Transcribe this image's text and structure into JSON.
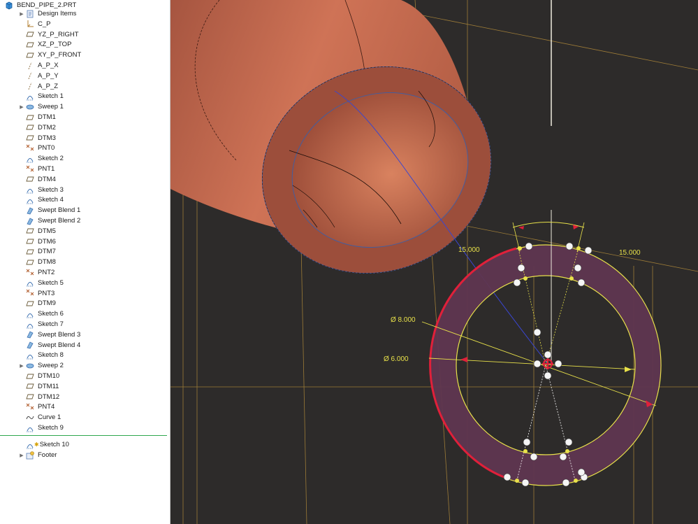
{
  "model_tree": {
    "root": "BEND_PIPE_2.PRT",
    "items": [
      {
        "label": "Design Items",
        "icon": "design-items-icon",
        "expandable": true
      },
      {
        "label": "C_P",
        "icon": "csys-icon"
      },
      {
        "label": "YZ_P_RIGHT",
        "icon": "datum-plane-icon"
      },
      {
        "label": "XZ_P_TOP",
        "icon": "datum-plane-icon"
      },
      {
        "label": "XY_P_FRONT",
        "icon": "datum-plane-icon"
      },
      {
        "label": "A_P_X",
        "icon": "datum-axis-icon"
      },
      {
        "label": "A_P_Y",
        "icon": "datum-axis-icon"
      },
      {
        "label": "A_P_Z",
        "icon": "datum-axis-icon"
      },
      {
        "label": "Sketch 1",
        "icon": "sketch-icon"
      },
      {
        "label": "Sweep 1",
        "icon": "sweep-icon",
        "expandable": true
      },
      {
        "label": "DTM1",
        "icon": "datum-plane-icon"
      },
      {
        "label": "DTM2",
        "icon": "datum-plane-icon"
      },
      {
        "label": "DTM3",
        "icon": "datum-plane-icon"
      },
      {
        "label": "PNT0",
        "icon": "datum-point-icon"
      },
      {
        "label": "Sketch 2",
        "icon": "sketch-icon"
      },
      {
        "label": "PNT1",
        "icon": "datum-point-icon"
      },
      {
        "label": "DTM4",
        "icon": "datum-plane-icon"
      },
      {
        "label": "Sketch 3",
        "icon": "sketch-icon"
      },
      {
        "label": "Sketch 4",
        "icon": "sketch-icon"
      },
      {
        "label": "Swept Blend 1",
        "icon": "swept-blend-icon"
      },
      {
        "label": "Swept Blend 2",
        "icon": "swept-blend-icon"
      },
      {
        "label": "DTM5",
        "icon": "datum-plane-icon"
      },
      {
        "label": "DTM6",
        "icon": "datum-plane-icon"
      },
      {
        "label": "DTM7",
        "icon": "datum-plane-icon"
      },
      {
        "label": "DTM8",
        "icon": "datum-plane-icon"
      },
      {
        "label": "PNT2",
        "icon": "datum-point-icon"
      },
      {
        "label": "Sketch 5",
        "icon": "sketch-icon"
      },
      {
        "label": "PNT3",
        "icon": "datum-point-icon"
      },
      {
        "label": "DTM9",
        "icon": "datum-plane-icon"
      },
      {
        "label": "Sketch 6",
        "icon": "sketch-icon"
      },
      {
        "label": "Sketch 7",
        "icon": "sketch-icon"
      },
      {
        "label": "Swept Blend 3",
        "icon": "swept-blend-icon"
      },
      {
        "label": "Swept Blend 4",
        "icon": "swept-blend-icon"
      },
      {
        "label": "Sketch 8",
        "icon": "sketch-icon"
      },
      {
        "label": "Sweep 2",
        "icon": "sweep-icon",
        "expandable": true
      },
      {
        "label": "DTM10",
        "icon": "datum-plane-icon"
      },
      {
        "label": "DTM11",
        "icon": "datum-plane-icon"
      },
      {
        "label": "DTM12",
        "icon": "datum-plane-icon"
      },
      {
        "label": "PNT4",
        "icon": "datum-point-icon"
      },
      {
        "label": "Curve 1",
        "icon": "curve-icon"
      },
      {
        "label": "Sketch 9",
        "icon": "sketch-icon"
      }
    ],
    "after_insert": [
      {
        "label": "Sketch 10",
        "icon": "sketch-icon"
      },
      {
        "label": "Footer",
        "icon": "footer-icon",
        "expandable": true
      }
    ]
  },
  "viewport": {
    "dimensions": {
      "angle_left": "15.000",
      "angle_right": "15.000",
      "outer_diameter": "Ø 8.000",
      "inner_diameter": "Ø 6.000"
    },
    "colors": {
      "background": "#2d2b2a",
      "pipe": "#c46a4e",
      "sketch_fill": "#5f3650",
      "sketch_lines": "#e8e14a",
      "highlight": "#e0203a",
      "datum": "#b08a3a"
    }
  }
}
